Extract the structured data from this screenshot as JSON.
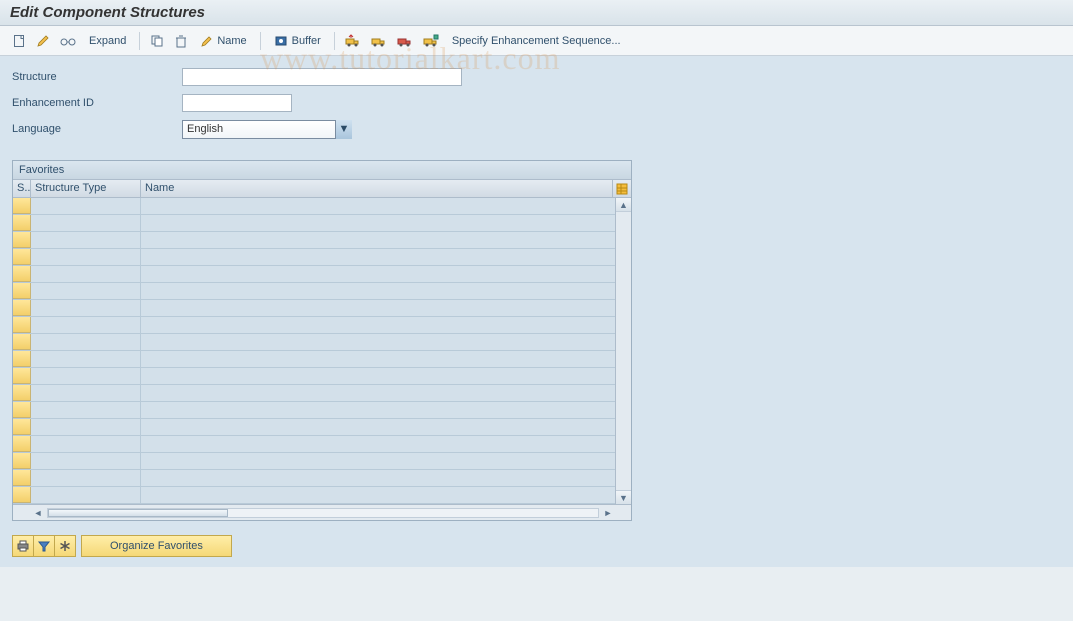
{
  "title": "Edit Component Structures",
  "watermark": "www.tutorialkart.com",
  "toolbar": {
    "expand_label": "Expand",
    "name_label": "Name",
    "buffer_label": "Buffer",
    "specify_label": "Specify Enhancement Sequence..."
  },
  "form": {
    "structure_label": "Structure",
    "structure_value": "",
    "enhancement_label": "Enhancement ID",
    "enhancement_value": "",
    "language_label": "Language",
    "language_value": "English"
  },
  "favorites": {
    "panel_title": "Favorites",
    "col_sel": "S..",
    "col_structure_type": "Structure Type",
    "col_name": "Name",
    "row_count": 18,
    "rows": []
  },
  "bottom": {
    "organize_label": "Organize Favorites"
  }
}
